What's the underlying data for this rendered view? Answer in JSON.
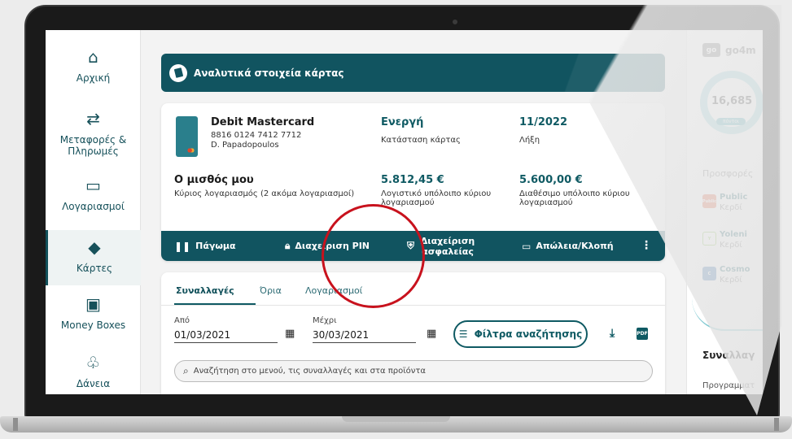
{
  "sidebar": {
    "items": [
      {
        "label": "Αρχική",
        "icon": "home-icon"
      },
      {
        "label": "Μεταφορές & Πληρωμές",
        "icon": "transfer-icon"
      },
      {
        "label": "Λογαριασμοί",
        "icon": "wallet-icon"
      },
      {
        "label": "Κάρτες",
        "icon": "card-icon",
        "active": true
      },
      {
        "label": "Money Boxes",
        "icon": "money-box-icon"
      },
      {
        "label": "Δάνεια",
        "icon": "loan-icon"
      }
    ]
  },
  "header": {
    "title": "Αναλυτικά στοιχεία κάρτας"
  },
  "card": {
    "name": "Debit Mastercard",
    "number": "8816 0124 7412 7712",
    "holder": "D. Papadopoulos",
    "status_value": "Ενεργή",
    "status_label": "Κατάσταση κάρτας",
    "expiry_value": "11/2022",
    "expiry_label": "Λήξη",
    "account_name": "Ο μισθός μου",
    "account_desc": "Κύριος λογαριασμός (2 ακόμα λογαριασμοί)",
    "ledger_value": "5.812,45 €",
    "ledger_label": "Λογιστικό υπόλοιπο κύριου λογαριασμού",
    "available_value": "5.600,00 €",
    "available_label": "Διαθέσιμο υπόλοιπο κύριου λογαριασμού"
  },
  "actions": {
    "freeze": "Πάγωμα",
    "pin": "Διαχείριση PIN",
    "security": "Διαχείριση ασφαλείας",
    "loss": "Απώλεια/Κλοπή"
  },
  "transactions": {
    "tabs": [
      "Συναλλαγές",
      "Όρια",
      "Λογαριασμοί"
    ],
    "from_label": "Από",
    "from_value": "01/03/2021",
    "to_label": "Μέχρι",
    "to_value": "30/03/2021",
    "filter_button": "Φίλτρα αναζήτησης",
    "pdf_label": "PDF",
    "search_placeholder": "Αναζήτηση στο μενού, τις συναλλαγές και στα προϊόντα"
  },
  "right_panel": {
    "logo_badge": "go",
    "logo_text": "go4m",
    "points_value": "16,685",
    "points_tag": "πόντοι",
    "offers_label": "Προσφορές",
    "offers": [
      {
        "title": "Public",
        "sub": "Κερδί",
        "logo": "Public",
        "color": "#e4502b"
      },
      {
        "title": "Yoleni",
        "sub": "Κερδί",
        "logo": "Y",
        "color": "#7bbf3d"
      },
      {
        "title": "Cosmo",
        "sub": "Κερδί",
        "logo": "C",
        "color": "#2561a8"
      }
    ],
    "section_title": "Συναλλαγ",
    "section_sub": "Προγραμματ"
  }
}
